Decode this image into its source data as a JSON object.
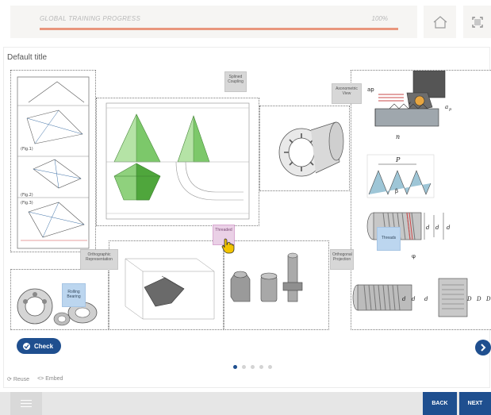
{
  "progress": {
    "label": "GLOBAL TRAINING PROGRESS",
    "percent_text": "100%",
    "value": 1.0
  },
  "card": {
    "title": "Default title"
  },
  "labels": {
    "splined_coupling": "Splined Coupling",
    "axonometric_view": "Axonometric View",
    "threaded": "Threaded",
    "orthographic_representation": "Orthographic Representation",
    "orthogonal_projection": "Orthogonal Projection",
    "threads": "Threads",
    "rolling_bearing": "Rolling Bearing"
  },
  "drawing_text": {
    "fig1": "(Fig.1)",
    "fig2": "(Fig.2)",
    "fig3": "(Fig.3)",
    "ap_label": "ap",
    "a_p": "a",
    "p_sub": "p",
    "n": "n",
    "vc": "v",
    "P": "P",
    "beta": "β",
    "phi": "φ",
    "d1": "d",
    "d2": "d",
    "d": "d",
    "D1": "D",
    "D2": "D",
    "D": "D"
  },
  "buttons": {
    "check": "Check",
    "back": "BACK",
    "next": "NEXT"
  },
  "footer": {
    "reuse": "Reuse",
    "embed": "Embed"
  },
  "pager": {
    "count": 5,
    "active": 1
  },
  "colors": {
    "accent": "#1f4f8f",
    "progress": "#e9967d"
  }
}
